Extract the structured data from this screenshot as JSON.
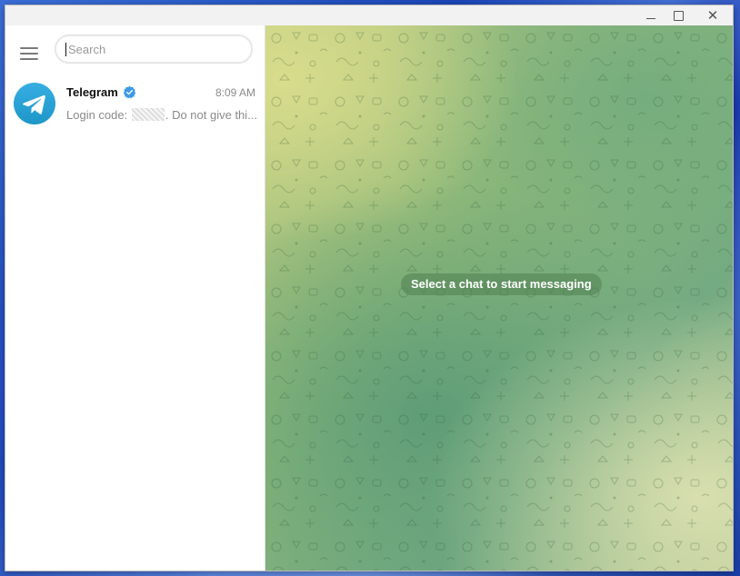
{
  "window": {
    "minimize_icon": "minimize-icon",
    "maximize_icon": "maximize-icon",
    "close_glyph": "✕"
  },
  "sidebar": {
    "menu_icon": "hamburger-menu-icon",
    "search": {
      "placeholder": "Search",
      "value": ""
    },
    "chats": [
      {
        "name": "Telegram",
        "verified": true,
        "time": "8:09 AM",
        "preview_prefix": "Login code: ",
        "preview_suffix": ". Do not give thi...",
        "avatar_icon": "telegram-plane-icon"
      }
    ]
  },
  "main": {
    "empty_state": "Select a chat to start messaging"
  },
  "colors": {
    "accent": "#2ea6d9",
    "verified": "#3d9ae8"
  }
}
